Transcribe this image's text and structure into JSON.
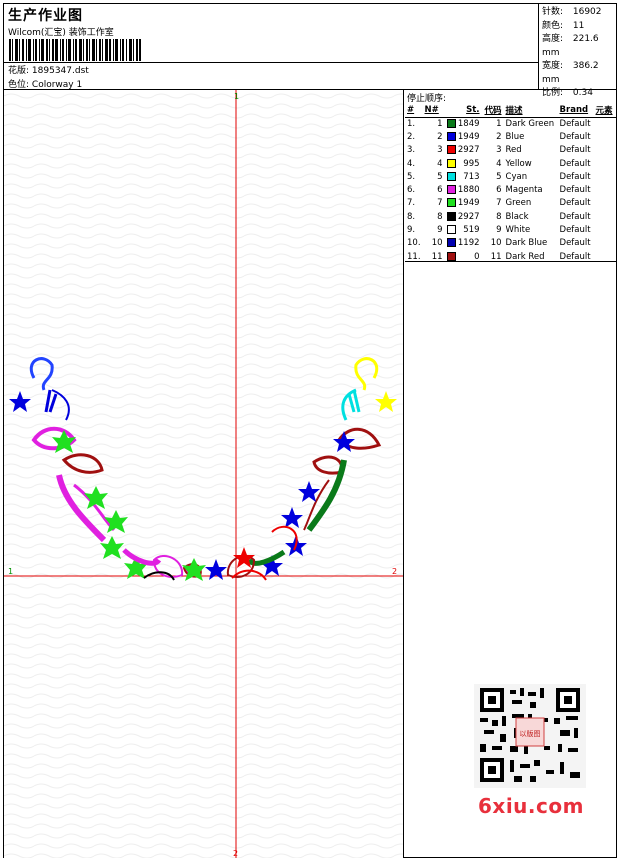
{
  "header": {
    "title": "生产作业图",
    "company": "Wilcom(汇宝) 装饰工作室",
    "design_label": "花版:",
    "design_value": "1895347.dst",
    "colorway_label": "色位:",
    "colorway_value": "Colorway 1"
  },
  "stats": [
    {
      "label": "针数:",
      "value": "16902"
    },
    {
      "label": "颜色:",
      "value": "11"
    },
    {
      "label": "高度:",
      "value": "221.6 mm"
    },
    {
      "label": "宽度:",
      "value": "386.2 mm"
    },
    {
      "label": "比例:",
      "value": "0.34"
    }
  ],
  "stops": {
    "title": "停止顺序:",
    "columns": [
      "#",
      "N#",
      "St.",
      "代码",
      "描述",
      "Brand",
      "元素"
    ],
    "rows": [
      {
        "idx": "1.",
        "n": "1",
        "color": "#0a7a1a",
        "st": "1849",
        "code": "1",
        "desc": "Dark Green",
        "brand": "Default"
      },
      {
        "idx": "2.",
        "n": "2",
        "color": "#0000dd",
        "st": "1949",
        "code": "2",
        "desc": "Blue",
        "brand": "Default"
      },
      {
        "idx": "3.",
        "n": "3",
        "color": "#ee0000",
        "st": "2927",
        "code": "3",
        "desc": "Red",
        "brand": "Default"
      },
      {
        "idx": "4.",
        "n": "4",
        "color": "#ffff00",
        "st": "995",
        "code": "4",
        "desc": "Yellow",
        "brand": "Default"
      },
      {
        "idx": "5.",
        "n": "5",
        "color": "#00e0e0",
        "st": "713",
        "code": "5",
        "desc": "Cyan",
        "brand": "Default"
      },
      {
        "idx": "6.",
        "n": "6",
        "color": "#e020e0",
        "st": "1880",
        "code": "6",
        "desc": "Magenta",
        "brand": "Default"
      },
      {
        "idx": "7.",
        "n": "7",
        "color": "#20e020",
        "st": "1949",
        "code": "7",
        "desc": "Green",
        "brand": "Default"
      },
      {
        "idx": "8.",
        "n": "8",
        "color": "#000000",
        "st": "2927",
        "code": "8",
        "desc": "Black",
        "brand": "Default"
      },
      {
        "idx": "9.",
        "n": "9",
        "color": "#ffffff",
        "st": "519",
        "code": "9",
        "desc": "White",
        "brand": "Default"
      },
      {
        "idx": "10.",
        "n": "10",
        "color": "#0000b0",
        "st": "1192",
        "code": "10",
        "desc": "Dark Blue",
        "brand": "Default"
      },
      {
        "idx": "11.",
        "n": "11",
        "color": "#a01010",
        "st": "0",
        "code": "11",
        "desc": "Dark Red",
        "brand": "Default"
      }
    ]
  },
  "axes": {
    "top": "1",
    "left": "1",
    "right": "2",
    "bottom": "2"
  },
  "watermark": "6xiu.com",
  "qr_seal": "以版图"
}
